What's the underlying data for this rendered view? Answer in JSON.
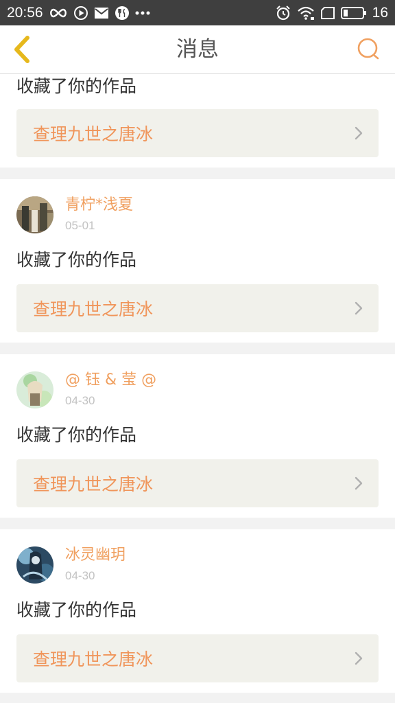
{
  "status_bar": {
    "time": "20:56",
    "battery": "16",
    "left_icons": [
      "infinity-icon",
      "play-circle-icon",
      "mail-icon",
      "restaurant-icon",
      "more-dots-icon"
    ],
    "right_icons": [
      "alarm-icon",
      "wifi-icon",
      "screen-rotate-icon",
      "battery-icon"
    ]
  },
  "header": {
    "title": "消息",
    "back_icon": "chevron-left-icon",
    "search_icon": "search-icon"
  },
  "colors": {
    "accent": "#f0a060",
    "work_title": "#f0955a",
    "work_box_bg": "#f1f1eb",
    "back_icon": "#e6b81c",
    "status_bar_bg": "#3f3f3f"
  },
  "notifications": [
    {
      "action": "收藏了你的作品",
      "work_title": "查理九世之唐冰"
    },
    {
      "user": "青柠*浅夏",
      "time": "05-01",
      "action": "收藏了你的作品",
      "work_title": "查理九世之唐冰"
    },
    {
      "user": "@ 钰 & 莹 @",
      "time": "04-30",
      "action": "收藏了你的作品",
      "work_title": "查理九世之唐冰"
    },
    {
      "user": "冰灵幽玥",
      "time": "04-30",
      "action": "收藏了你的作品",
      "work_title": "查理九世之唐冰"
    }
  ]
}
